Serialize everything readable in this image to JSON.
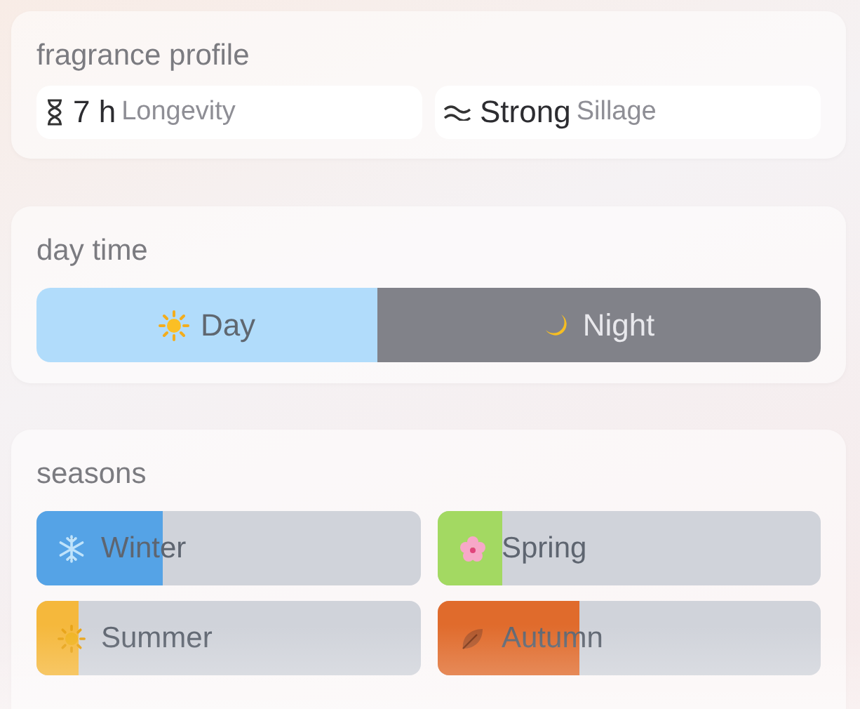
{
  "profile": {
    "title": "fragrance profile",
    "stats": [
      {
        "kind": "longevity",
        "value": "7 h",
        "label": "Longevity"
      },
      {
        "kind": "sillage",
        "value": "Strong",
        "label": "Sillage"
      }
    ]
  },
  "day_time": {
    "title": "day time",
    "options": [
      {
        "kind": "day",
        "label": "Day",
        "selected": true
      },
      {
        "kind": "night",
        "label": "Night",
        "selected": false
      }
    ]
  },
  "seasons": {
    "title": "seasons",
    "items": [
      {
        "kind": "winter",
        "label": "Winter",
        "level": 0.33,
        "color": "#55a3e6"
      },
      {
        "kind": "spring",
        "label": "Spring",
        "level": 0.17,
        "color": "#a3d962"
      },
      {
        "kind": "summer",
        "label": "Summer",
        "level": 0.11,
        "color": "#f5b83c"
      },
      {
        "kind": "autumn",
        "label": "Autumn",
        "level": 0.37,
        "color": "#e06b2c"
      }
    ]
  }
}
